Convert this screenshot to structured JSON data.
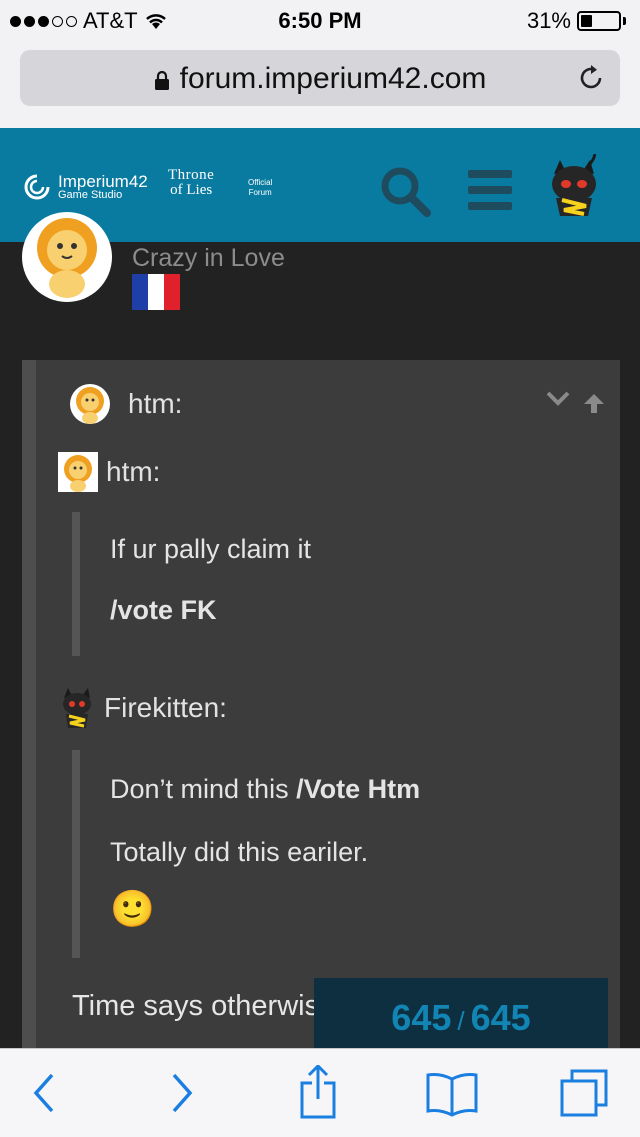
{
  "status_bar": {
    "carrier": "AT&T",
    "time": "6:50 PM",
    "battery": "31%",
    "battery_level": 0.31,
    "signal_bars": 3
  },
  "browser": {
    "url": "forum.imperium42.com"
  },
  "forum_header": {
    "brand_name": "Imperium42",
    "brand_sub": "Game Studio",
    "game_line1": "Throne",
    "game_line2": "of Lies",
    "official_line1": "Official",
    "official_line2": "Forum"
  },
  "post_author": {
    "user_title": "Crazy in Love"
  },
  "quote": {
    "author": "htm:",
    "nested_author": "htm:",
    "nested_lines": [
      "If ur pally claim it",
      "/vote FK"
    ],
    "second_author": "Firekitten:",
    "second_line1_normal": "Don’t mind this ",
    "second_line1_bold": "/Vote Htm",
    "second_line2": "Totally did this eariler.",
    "emoji": "🙂"
  },
  "body_text": "Time says otherwis",
  "progress": {
    "current": "645",
    "separator": "/",
    "total": "645"
  },
  "colors": {
    "header_bg": "#0a7ba0",
    "link_blue": "#1a7fe0",
    "progress_text": "#1285b4"
  }
}
